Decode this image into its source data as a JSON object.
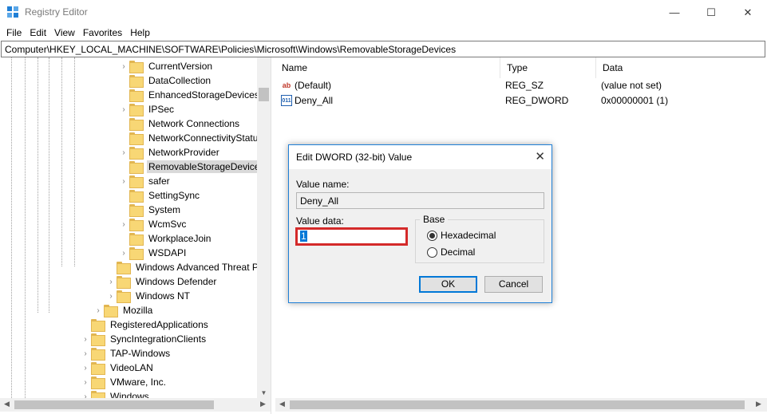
{
  "window": {
    "title": "Registry Editor",
    "minimize": "—",
    "maximize": "☐",
    "close": "✕"
  },
  "menu": [
    "File",
    "Edit",
    "View",
    "Favorites",
    "Help"
  ],
  "address": "Computer\\HKEY_LOCAL_MACHINE\\SOFTWARE\\Policies\\Microsoft\\Windows\\RemovableStorageDevices",
  "tree": [
    {
      "label": "CurrentVersion",
      "expandable": true
    },
    {
      "label": "DataCollection",
      "expandable": false
    },
    {
      "label": "EnhancedStorageDevices",
      "expandable": false
    },
    {
      "label": "IPSec",
      "expandable": true
    },
    {
      "label": "Network Connections",
      "expandable": false
    },
    {
      "label": "NetworkConnectivityStatusIndicato",
      "expandable": false
    },
    {
      "label": "NetworkProvider",
      "expandable": true
    },
    {
      "label": "RemovableStorageDevices",
      "expandable": false,
      "selected": true
    },
    {
      "label": "safer",
      "expandable": true
    },
    {
      "label": "SettingSync",
      "expandable": false
    },
    {
      "label": "System",
      "expandable": false
    },
    {
      "label": "WcmSvc",
      "expandable": true
    },
    {
      "label": "WorkplaceJoin",
      "expandable": false
    },
    {
      "label": "WSDAPI",
      "expandable": true
    },
    {
      "label": "Windows Advanced Threat Protection",
      "expandable": false
    },
    {
      "label": "Windows Defender",
      "expandable": true
    },
    {
      "label": "Windows NT",
      "expandable": true
    },
    {
      "label": "Mozilla",
      "expandable": true
    },
    {
      "label": "RegisteredApplications",
      "expandable": false
    },
    {
      "label": "SyncIntegrationClients",
      "expandable": true
    },
    {
      "label": "TAP-Windows",
      "expandable": true
    },
    {
      "label": "VideoLAN",
      "expandable": true
    },
    {
      "label": "VMware, Inc.",
      "expandable": true
    },
    {
      "label": "Windows",
      "expandable": true
    }
  ],
  "values": {
    "headers": {
      "name": "Name",
      "type": "Type",
      "data": "Data"
    },
    "rows": [
      {
        "icon": "string-value-icon",
        "glyph": "ab",
        "name": "(Default)",
        "type": "REG_SZ",
        "data": "(value not set)"
      },
      {
        "icon": "binary-value-icon",
        "glyph": "011",
        "name": "Deny_All",
        "type": "REG_DWORD",
        "data": "0x00000001 (1)"
      }
    ]
  },
  "dialog": {
    "title": "Edit DWORD (32-bit) Value",
    "value_name_label": "Value name:",
    "value_name": "Deny_All",
    "value_data_label": "Value data:",
    "value_data": "1",
    "base_label": "Base",
    "hex_label": "Hexadecimal",
    "dec_label": "Decimal",
    "base_selected": "Hexadecimal",
    "ok_label": "OK",
    "cancel_label": "Cancel"
  }
}
